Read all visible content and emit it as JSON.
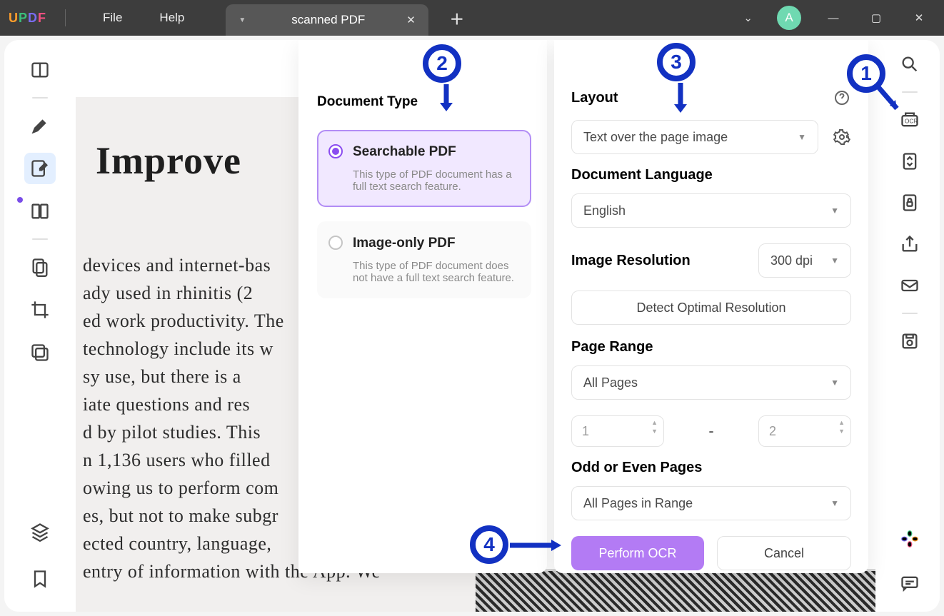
{
  "titlebar": {
    "menu_file": "File",
    "menu_help": "Help",
    "tab_label": "scanned PDF",
    "avatar_letter": "A"
  },
  "doc": {
    "heading": "Improve",
    "body": "devices and internet-bas\nady used in rhinitis (2\ned work productivity. The\ntechnology include its w\nsy use, but there is a\niate questions and res\nd by pilot studies. This\nn 1,136 users who filled\nowing us to perform com\nes, but not to make subgr\nected country, language,\nentry of information with the App. We"
  },
  "ocr_left": {
    "heading": "Document Type",
    "opt1_title": "Searchable PDF",
    "opt1_desc": "This type of PDF document has a full text search feature.",
    "opt2_title": "Image-only PDF",
    "opt2_desc": "This type of PDF document does not have a full text search feature."
  },
  "ocr_right": {
    "layout_label": "Layout",
    "layout_value": "Text over the page image",
    "lang_label": "Document Language",
    "lang_value": "English",
    "res_label": "Image Resolution",
    "res_value": "300 dpi",
    "detect_btn": "Detect Optimal Resolution",
    "range_label": "Page Range",
    "range_value": "All Pages",
    "from": "1",
    "to": "2",
    "dash": "-",
    "odd_label": "Odd or Even Pages",
    "odd_value": "All Pages in Range",
    "perform": "Perform OCR",
    "cancel": "Cancel"
  },
  "annotations": {
    "n1": "1",
    "n2": "2",
    "n3": "3",
    "n4": "4"
  }
}
